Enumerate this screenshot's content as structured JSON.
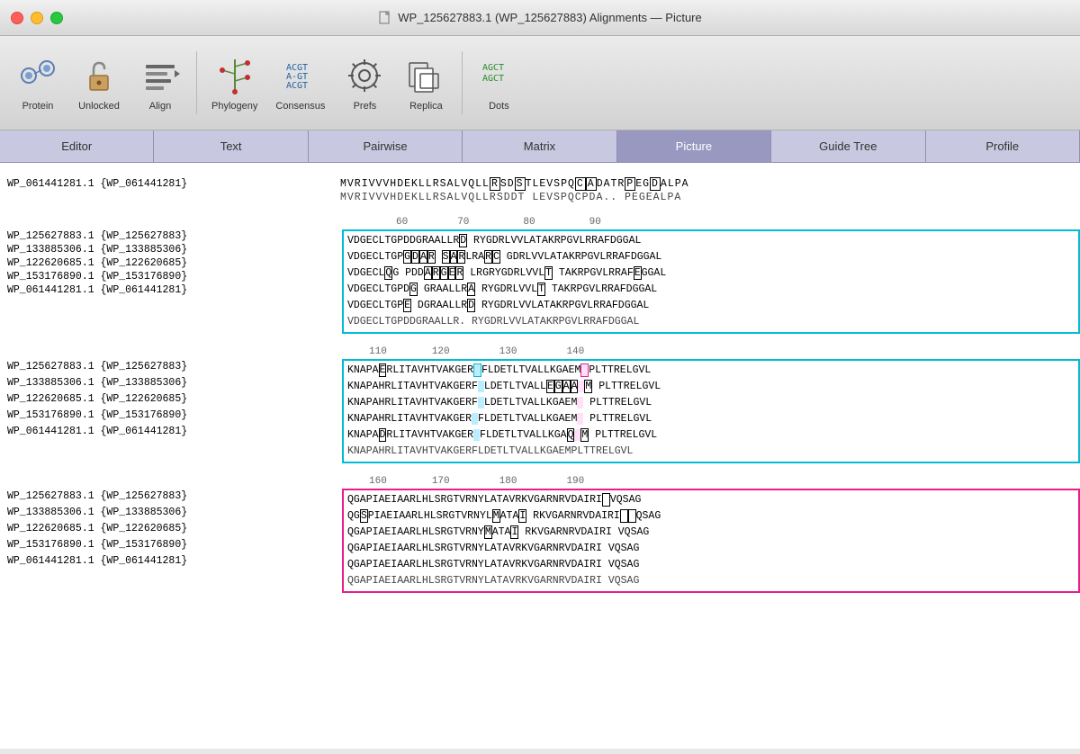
{
  "window": {
    "title": "WP_125627883.1 (WP_125627883) Alignments — Picture"
  },
  "toolbar": {
    "items": [
      {
        "id": "protein",
        "label": "Protein",
        "icon": "protein"
      },
      {
        "id": "unlocked",
        "label": "Unlocked",
        "icon": "unlocked"
      },
      {
        "id": "align",
        "label": "Align",
        "icon": "align"
      },
      {
        "id": "phylogeny",
        "label": "Phylogeny",
        "icon": "phylogeny"
      },
      {
        "id": "consensus",
        "label": "Consensus",
        "icon": "consensus"
      },
      {
        "id": "prefs",
        "label": "Prefs",
        "icon": "prefs"
      },
      {
        "id": "replica",
        "label": "Replica",
        "icon": "replica"
      },
      {
        "id": "dots",
        "label": "Dots",
        "icon": "dots"
      }
    ]
  },
  "tabs": [
    {
      "id": "editor",
      "label": "Editor",
      "active": false
    },
    {
      "id": "text",
      "label": "Text",
      "active": false
    },
    {
      "id": "pairwise",
      "label": "Pairwise",
      "active": false
    },
    {
      "id": "matrix",
      "label": "Matrix",
      "active": false
    },
    {
      "id": "picture",
      "label": "Picture",
      "active": true
    },
    {
      "id": "guide-tree",
      "label": "Guide Tree",
      "active": false
    },
    {
      "id": "profile",
      "label": "Profile",
      "active": false
    }
  ],
  "sequences": {
    "group0": {
      "seqs": [
        {
          "name": "WP_061441281.1 {WP_061441281}",
          "data": "MVRIVVVHDEKLLRSALVQLLRSDS TLEVSPQCADATR PEGDALPA"
        },
        {
          "name": "",
          "data": "MVRIVVVHDEKLLRSALVQLLRSDDT LEVSPQCPDA.. PEGEALPA"
        }
      ]
    },
    "group1": {
      "numbers": [
        "60",
        "70",
        "80",
        "90"
      ],
      "seqs": [
        {
          "name": "WP_125627883.1 {WP_125627883}",
          "data": "VDGECLTGPDDGRAALLRD RYGDRLVVLATAKRPGVLRRAFDGGAL"
        },
        {
          "name": "WP_133885306.1 {WP_133885306}",
          "data": "VDGECLTGP GDAR SAR LRARC GDRLVVLATAKRPGVLRRAFDGGAL"
        },
        {
          "name": "WP_122620685.1 {WP_122620685}",
          "data": "VDGECL QG PDD ARGER LRGRYGDRLVVL TTAKRPGVLRRAF EGGAL"
        },
        {
          "name": "WP_153176890.1 {WP_153176890}",
          "data": "VDGECLTGPD GGRAALLRA RYGDRLVVL TTAKRPGVLRRAFDGGAL"
        },
        {
          "name": "WP_061441281.1 {WP_061441281}",
          "data": "VDGECLTGP EDGRAALLRD RYGDRLVVLATAKRPGVLRRAFDGGAL"
        },
        {
          "name": "",
          "data": "VDGECLTGPDDGRAALLR.RYGDRLVVLATAKRPGVLRRAFDGGAL"
        }
      ]
    },
    "group2": {
      "numbers": [
        "110",
        "120",
        "130",
        "140"
      ],
      "seqs": [
        {
          "name": "WP_125627883.1 {WP_125627883}",
          "data": "KNAPAE RLITAVHTVAKGER FLDETLTVALLKGAEM PLTTRELGVL"
        },
        {
          "name": "WP_133885306.1 {WP_133885306}",
          "data": "KNAPAHRLITAVHTVAKGERF LDETLTVALL EGAA M PLTTRELGVL"
        },
        {
          "name": "WP_122620685.1 {WP_122620685}",
          "data": "KNAPAHRLITAVHTVAKGERF LDETLTVALLKGAEM PLTTRELGVL"
        },
        {
          "name": "WP_153176890.1 {WP_153176890}",
          "data": "KNAPAHRLITAVHTVAKGER FLDETLTVALLKGAEM PLTTRELGVL"
        },
        {
          "name": "WP_061441281.1 {WP_061441281}",
          "data": "KNAPAD RLITAVHTVAKGER FLDETLTVALLKGA QM PLTTRELGVL"
        },
        {
          "name": "",
          "data": "KNAPAHRLITAVHTVAKGERFLDETLTVALLKGAEMPLTTRELGVL"
        }
      ]
    },
    "group3": {
      "numbers": [
        "160",
        "170",
        "180",
        "190"
      ],
      "seqs": [
        {
          "name": "WP_125627883.1 {WP_125627883}",
          "data": "QGAPIAEIAARLHLSRGTVRNYLATAVRKVGARNRVDAIRI VQSAG"
        },
        {
          "name": "WP_133885306.1 {WP_133885306}",
          "data": "QG S PIAEIAARLHLSRGTVRNYL MATA I RKVGARNRVDAIRI  QSAG"
        },
        {
          "name": "WP_122620685.1 {WP_122620685}",
          "data": "QGAPIAEIAARLHLSRGTVRNY MATA I RKVGARNRVDAIRI VQSAG"
        },
        {
          "name": "WP_153176890.1 {WP_153176890}",
          "data": "QGAPIAEIAARLHLSRGTVRNYLATAVRKVGARNRVDAIRI VQSAG"
        },
        {
          "name": "WP_061441281.1 {WP_061441281}",
          "data": "QGAPIAEIAARLHLSRGTVRNYLATAVRKVGARNRVDAIRI VQSAG"
        },
        {
          "name": "",
          "data": "QGAPIAEIAARLHLSRGTVRNYLATAVRKVGARNRVDAIRI VQSAG"
        }
      ]
    }
  }
}
